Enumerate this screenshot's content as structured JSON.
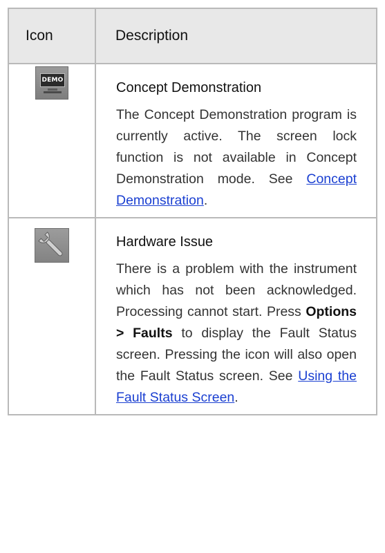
{
  "table": {
    "header": {
      "icon": "Icon",
      "description": "Description"
    },
    "rows": [
      {
        "icon": "demo-monitor-icon",
        "title": "Concept Demonstration",
        "body_text": "The Concept Demonstration program is currently active. The screen lock function is not available in Concept Demonstration mode. See ",
        "link": "Concept Demonstration",
        "trailing": ".",
        "icon_text": "DEMO"
      },
      {
        "icon": "wrench-icon",
        "title": "Hardware Issue",
        "body_text_1": "There is a problem with the instrument which has not been acknowledged. Processing cannot start. Press ",
        "bold_1": "Options",
        "mid": " > ",
        "bold_2": "Faults",
        "body_text_2": " to display the Fault Status screen. Pressing the icon will also open the Fault Status screen. See ",
        "link": "Using the Fault Status Screen",
        "trailing": "."
      }
    ]
  },
  "colors": {
    "header_bg": "#e8e8e8",
    "border": "#b9b9b9",
    "link": "#1a3fd1"
  }
}
